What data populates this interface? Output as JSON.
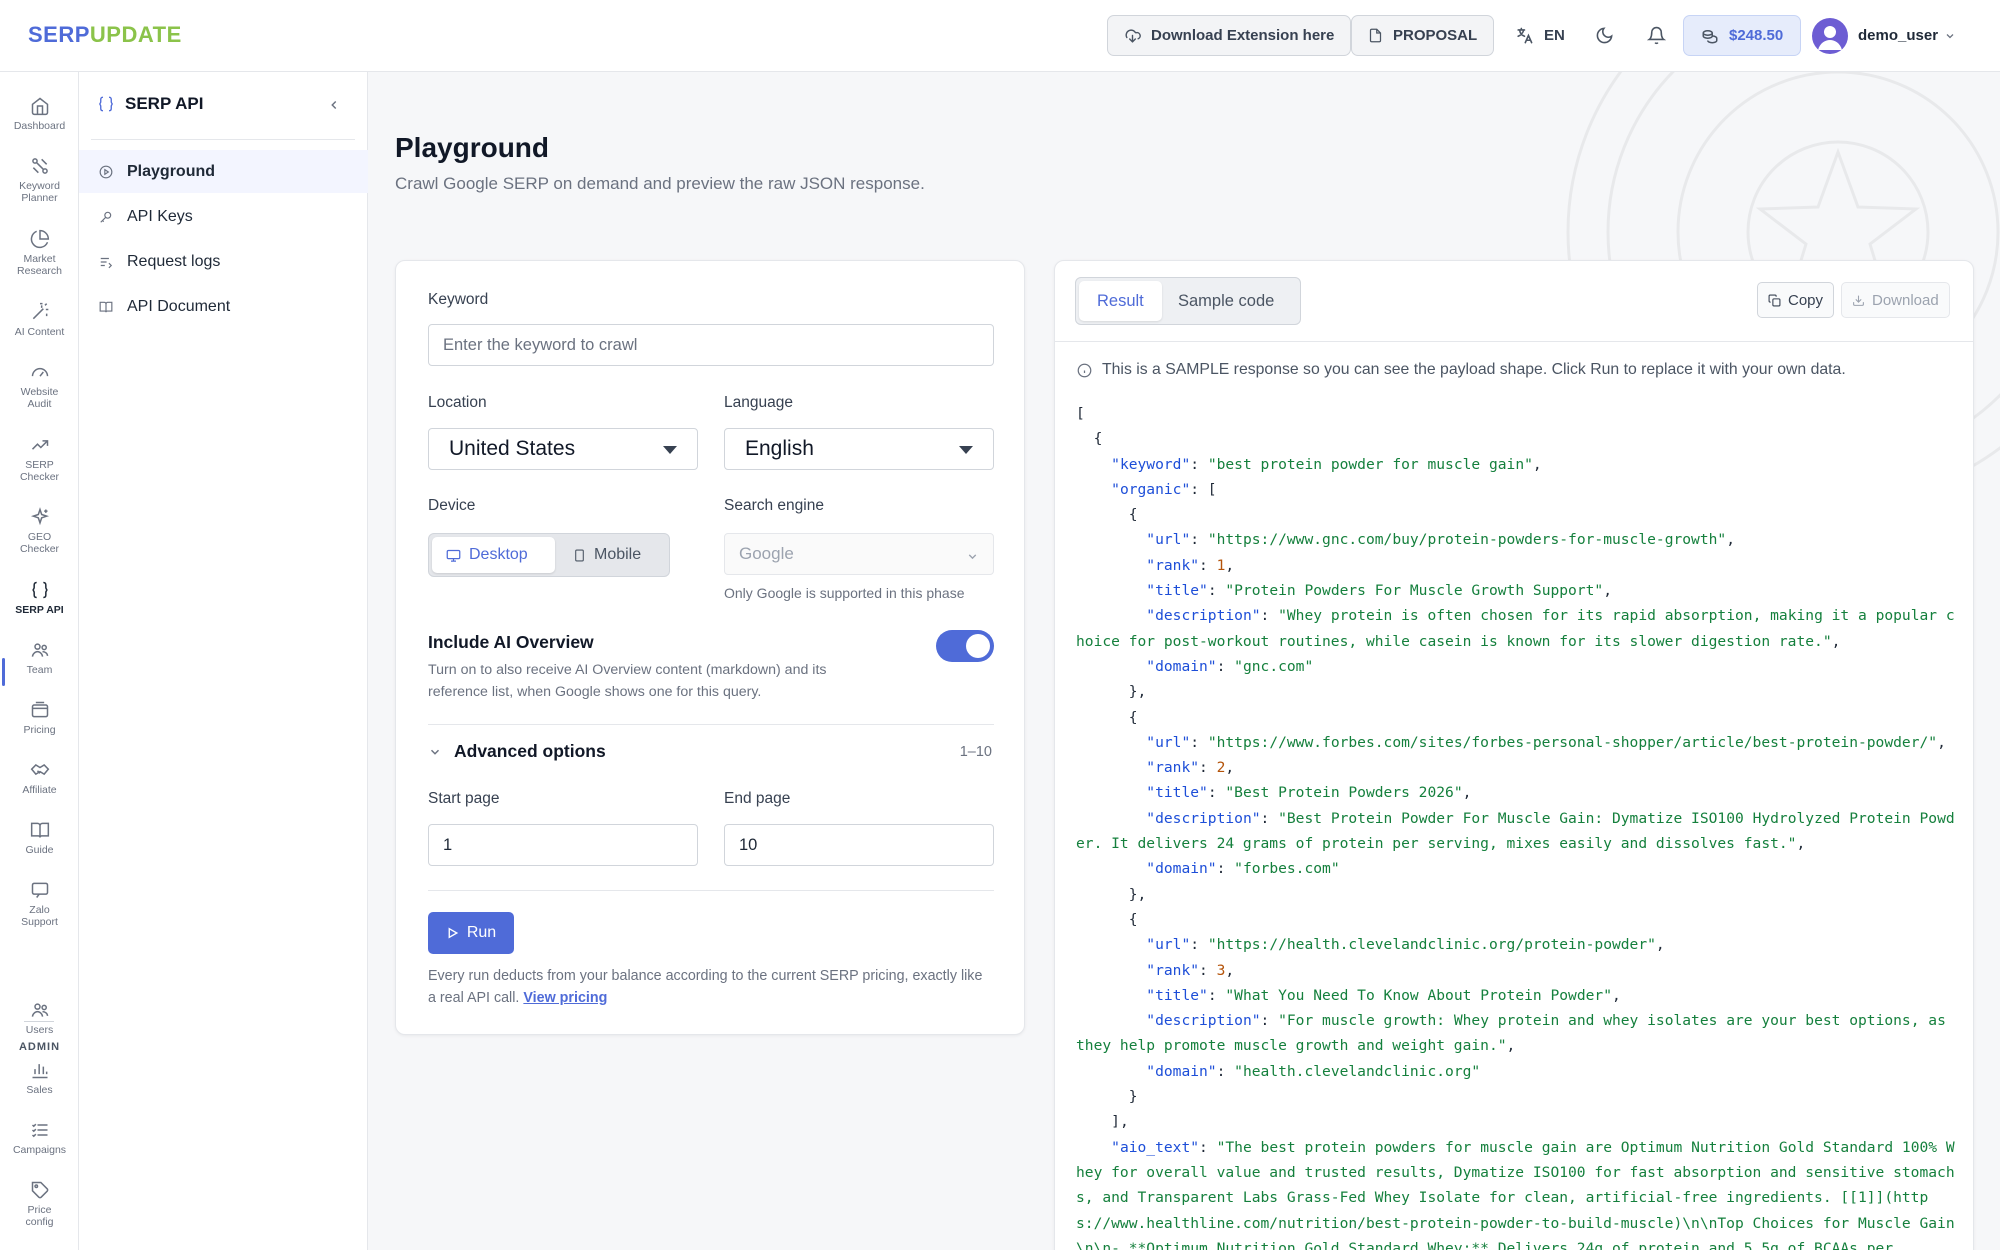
{
  "brand": {
    "part1": "SERP",
    "part2": "UPDATE"
  },
  "topbar": {
    "extension_label": "Download Extension here",
    "proposal_label": "PROPOSAL",
    "lang_label": "EN",
    "balance": "$248.50",
    "username": "demo_user"
  },
  "rail": [
    {
      "label": "Dashboard",
      "icon": "home-icon"
    },
    {
      "label": "Keyword Planner",
      "icon": "keyword-icon"
    },
    {
      "label": "Market Research",
      "icon": "pie-icon"
    },
    {
      "label": "AI Content",
      "icon": "wand-icon"
    },
    {
      "label": "Website Audit",
      "icon": "gauge-icon"
    },
    {
      "label": "SERP Checker",
      "icon": "trend-icon"
    },
    {
      "label": "GEO Checker",
      "icon": "sparkle-icon"
    },
    {
      "label": "SERP API",
      "icon": "braces-icon",
      "active": true
    },
    {
      "label": "Team",
      "icon": "team-icon"
    },
    {
      "label": "Pricing",
      "icon": "wallet-icon"
    },
    {
      "label": "Affiliate",
      "icon": "handshake-icon"
    },
    {
      "label": "Guide",
      "icon": "book-icon"
    },
    {
      "label": "Zalo Support",
      "icon": "chat-icon"
    }
  ],
  "admin_label": "ADMIN",
  "admin_rail": [
    {
      "label": "Users",
      "icon": "users-icon"
    },
    {
      "label": "Sales",
      "icon": "bar-chart-icon"
    },
    {
      "label": "Campaigns",
      "icon": "list-icon"
    },
    {
      "label": "Price config",
      "icon": "tag-icon"
    }
  ],
  "sidebar": {
    "title": "SERP API",
    "items": [
      {
        "label": "Playground",
        "icon": "play-circle-icon",
        "active": true
      },
      {
        "label": "API Keys",
        "icon": "key-icon"
      },
      {
        "label": "Request logs",
        "icon": "list-filter-icon"
      },
      {
        "label": "API Document",
        "icon": "book-open-icon"
      }
    ]
  },
  "page": {
    "title": "Playground",
    "subtitle": "Crawl Google SERP on demand and preview the raw JSON response."
  },
  "form": {
    "keyword_label": "Keyword",
    "keyword_placeholder": "Enter the keyword to crawl",
    "location_label": "Location",
    "location_value": "United States",
    "language_label": "Language",
    "language_value": "English",
    "device_label": "Device",
    "device_desktop": "Desktop",
    "device_mobile": "Mobile",
    "device_selected": "Desktop",
    "engine_label": "Search engine",
    "engine_value": "Google",
    "engine_hint": "Only Google is supported in this phase",
    "ai_title": "Include AI Overview",
    "ai_desc": "Turn on to also receive AI Overview content (markdown) and its reference list, when Google shows one for this query.",
    "ai_enabled": true,
    "advanced_label": "Advanced options",
    "advanced_range": "1–10",
    "start_label": "Start page",
    "start_value": "1",
    "end_label": "End page",
    "end_value": "10",
    "run_label": "Run",
    "note_text": "Every run deducts from your balance according to the current SERP pricing, exactly like a real API call.",
    "note_link": "View pricing"
  },
  "result": {
    "tab_result": "Result",
    "tab_code": "Sample code",
    "active_tab": "Result",
    "copy_label": "Copy",
    "download_label": "Download",
    "info_text": "This is a SAMPLE response so you can see the payload shape. Click Run to replace it with your own data.",
    "keyword": "best protein powder for muscle gain",
    "organic": [
      {
        "url": "https://www.gnc.com/buy/protein-powders-for-muscle-growth",
        "rank": 1,
        "title": "Protein Powders For Muscle Growth Support",
        "description": "Whey protein is often chosen for its rapid absorption, making it a popular choice for post-workout routines, while casein is known for its slower digestion rate.",
        "domain": "gnc.com"
      },
      {
        "url": "https://www.forbes.com/sites/forbes-personal-shopper/article/best-protein-powder/",
        "rank": 2,
        "title": "Best Protein Powders 2026",
        "description": "Best Protein Powder For Muscle Gain: Dymatize ISO100 Hydrolyzed Protein Powder. It delivers 24 grams of protein per serving, mixes easily and dissolves fast.",
        "domain": "forbes.com"
      },
      {
        "url": "https://health.clevelandclinic.org/protein-powder",
        "rank": 3,
        "title": "What You Need To Know About Protein Powder",
        "description": "For muscle growth: Whey protein and whey isolates are your best options, as they help promote muscle growth and weight gain.",
        "domain": "health.clevelandclinic.org"
      }
    ],
    "aio_text": "The best protein powders for muscle gain are Optimum Nutrition Gold Standard 100% Whey for overall value and trusted results, Dymatize ISO100 for fast absorption and sensitive stomachs, and Transparent Labs Grass-Fed Whey Isolate for clean, artificial-free ingredients. [[1]](https://www.healthline.com/nutrition/best-protein-powder-to-build-muscle)\\n\\nTop Choices for Muscle Gain\\n\\n- **Optimum Nutrition Gold Standard Whey:** Delivers 24g of protein and 5.5g of BCAAs per"
  }
}
